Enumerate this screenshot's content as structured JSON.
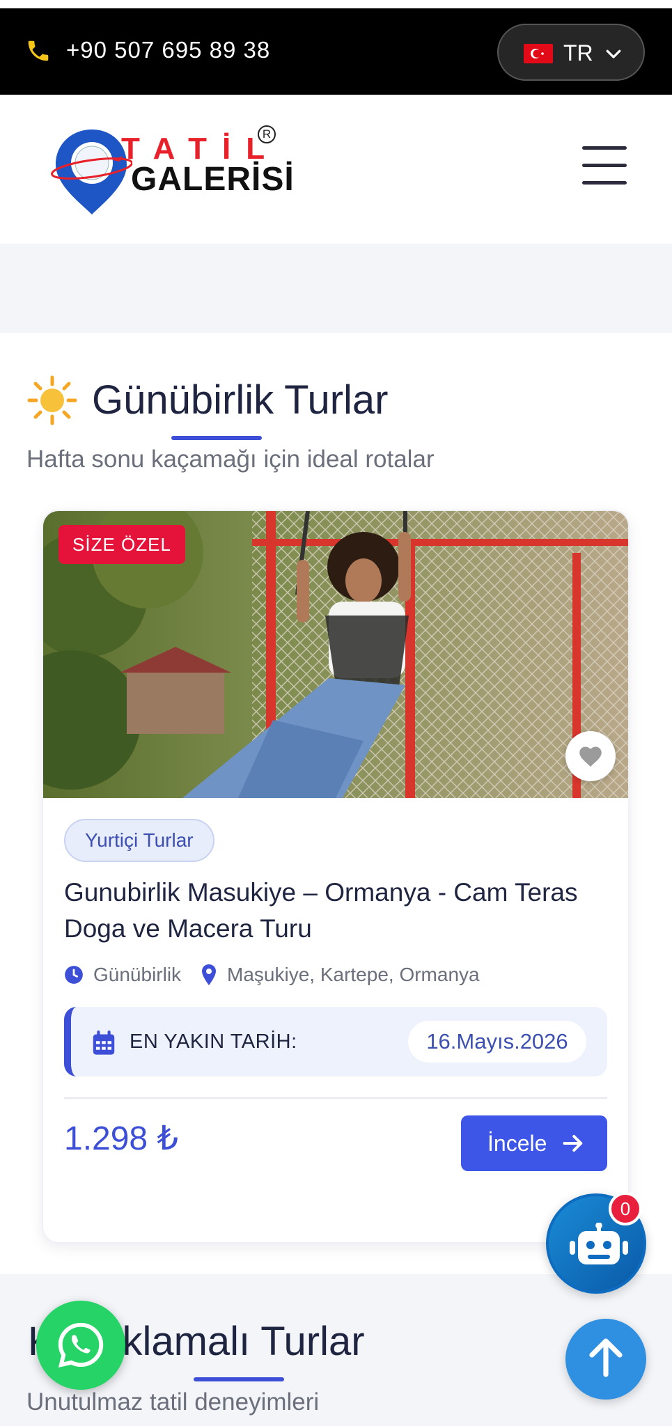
{
  "topbar": {
    "phone": "+90 507 695 89 38",
    "language": "TR"
  },
  "logo": {
    "line1": "TATİL",
    "line2": "GALERİSİ",
    "registered": "R"
  },
  "section_day_tours": {
    "title": "Günübirlik Turlar",
    "subtitle": "Hafta sonu kaçamağı için ideal rotalar",
    "card": {
      "badge": "SİZE ÖZEL",
      "category": "Yurtiçi Turlar",
      "title": "Gunubirlik Masukiye – Ormanya - Cam Teras Doga ve Macera Turu",
      "duration": "Günübirlik",
      "location": "Maşukiye, Kartepe, Ormanya",
      "date_label": "EN YAKIN TARİH:",
      "date_value": "16.Mayıs.2026",
      "price": "1.298 ₺",
      "button_label": "İncele"
    }
  },
  "section_accommodation": {
    "title": "Konaklamalı Turlar",
    "subtitle": "Unutulmaz tatil deneyimleri"
  },
  "chatbot": {
    "badge_count": "0"
  },
  "colors": {
    "accent": "#3d4fd6",
    "badge_red": "#e5133a",
    "whatsapp": "#25d366",
    "chatbot": "#1a8bd6",
    "scroll_top": "#2f8fe0"
  },
  "icons": [
    "phone-icon",
    "turkey-flag-icon",
    "chevron-down-icon",
    "hamburger-menu-icon",
    "sun-icon",
    "heart-icon",
    "clock-icon",
    "map-pin-icon",
    "calendar-icon",
    "arrow-right-icon",
    "whatsapp-icon",
    "robot-icon",
    "arrow-up-icon"
  ]
}
